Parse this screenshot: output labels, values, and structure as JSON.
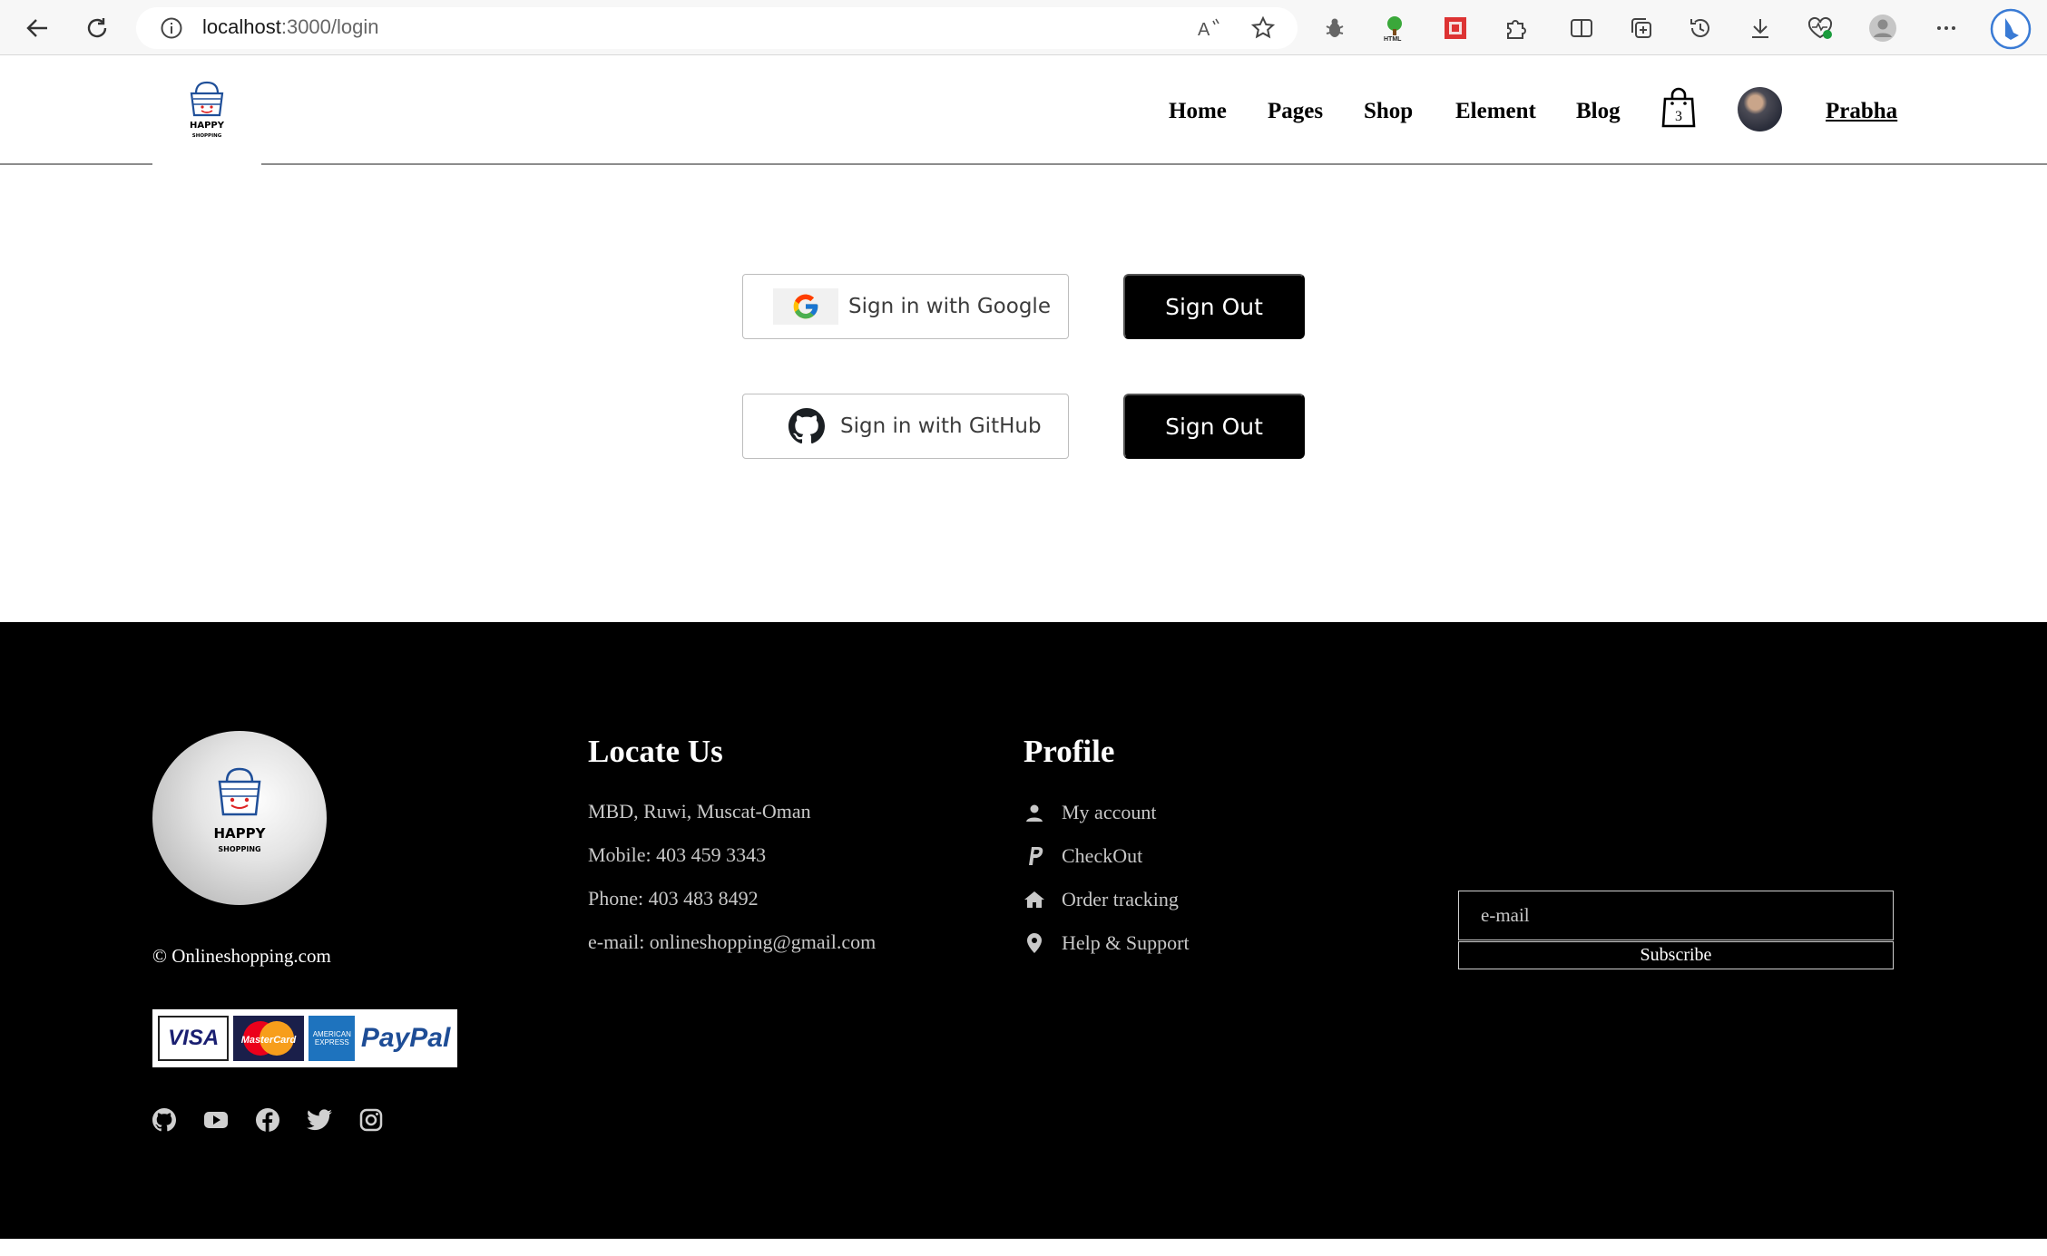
{
  "browser": {
    "url_host": "localhost",
    "url_path": ":3000/login",
    "icons": [
      "back-arrow-icon",
      "refresh-icon",
      "site-info-icon",
      "read-aloud-icon",
      "favorite-star-icon",
      "bug-extension-icon",
      "html-tree-extension-icon",
      "red-extension-icon",
      "extensions-puzzle-icon",
      "split-screen-icon",
      "collections-icon",
      "history-icon",
      "downloads-icon",
      "performance-heart-icon",
      "profile-icon",
      "more-menu-icon",
      "bing-icon"
    ]
  },
  "header": {
    "logo_text": "HAPPY",
    "logo_subtext": "SHOPPING",
    "nav": [
      "Home",
      "Pages",
      "Shop",
      "Element",
      "Blog"
    ],
    "cart_count": "3",
    "username": "Prabha"
  },
  "auth": {
    "google_label": "Sign in with Google",
    "github_label": "Sign in with GitHub",
    "signout_label": "Sign Out"
  },
  "footer": {
    "logo_text": "HAPPY",
    "logo_subtext": "SHOPPING",
    "copyright": "© Onlineshopping.com",
    "payment_cards": [
      "VISA",
      "MasterCard",
      "AMERICAN EXPRESS",
      "PayPal"
    ],
    "social_icons": [
      "github-icon",
      "youtube-icon",
      "facebook-icon",
      "twitter-icon",
      "instagram-icon"
    ],
    "locate": {
      "title": "Locate Us",
      "lines": [
        "MBD, Ruwi, Muscat-Oman",
        "Mobile: 403 459 3343",
        "Phone: 403 483 8492",
        "e-mail: onlineshopping@gmail.com"
      ]
    },
    "profile": {
      "title": "Profile",
      "items": [
        "My account",
        "CheckOut",
        "Order tracking",
        "Help & Support"
      ]
    },
    "newsletter": {
      "placeholder": "e-mail",
      "button": "Subscribe"
    }
  },
  "colors": {
    "footer_bg": "#000000",
    "button_bg": "#000000",
    "page_bg": "#ffffff"
  }
}
